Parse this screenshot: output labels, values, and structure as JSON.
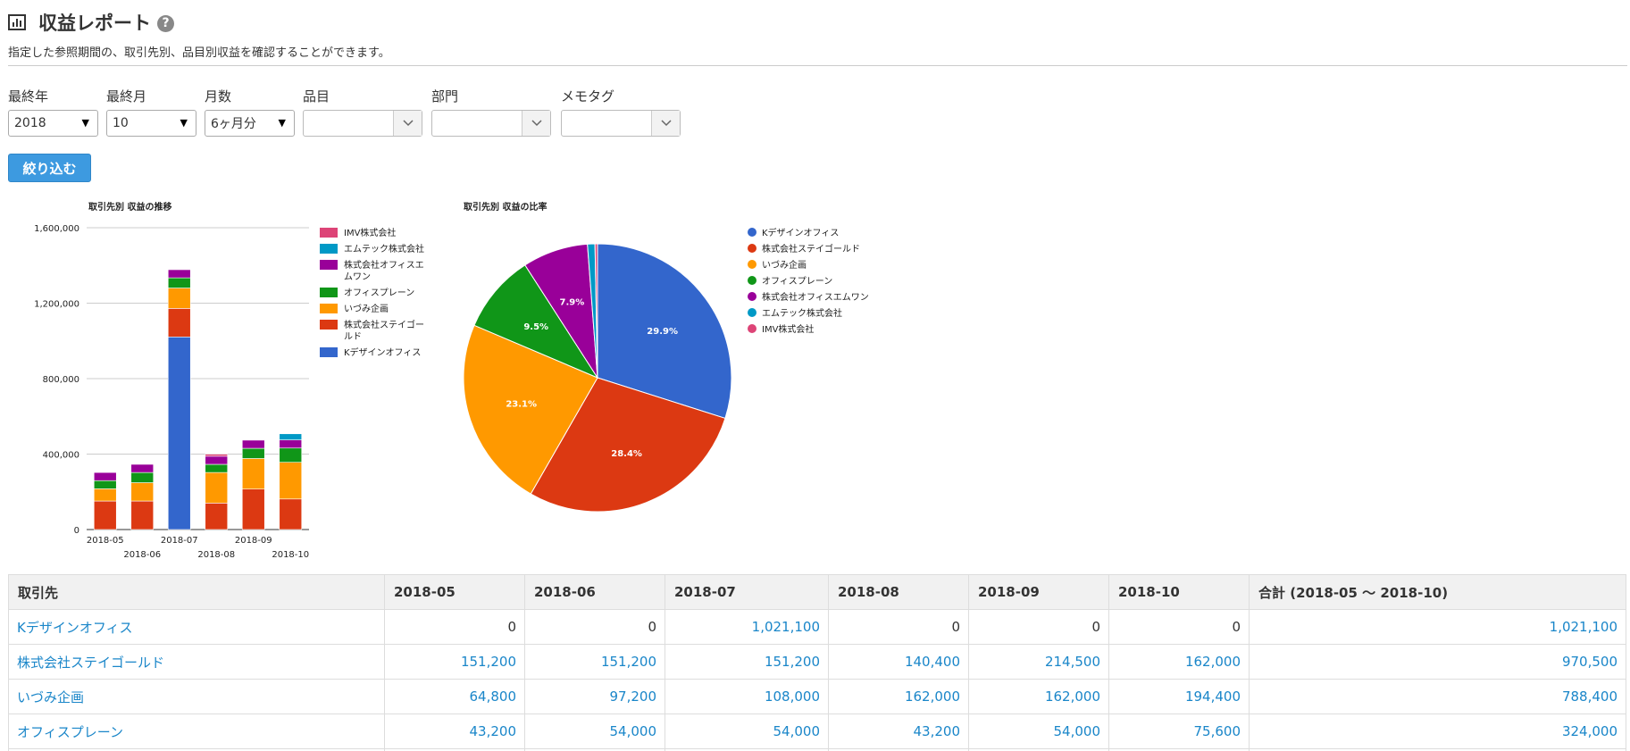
{
  "header": {
    "title": "収益レポート",
    "help": "?",
    "subtitle": "指定した参照期間の、取引先別、品目別収益を確認することができます。"
  },
  "filters": {
    "year_label": "最終年",
    "year_value": "2018",
    "month_label": "最終月",
    "month_value": "10",
    "count_label": "月数",
    "count_value": "6ヶ月分",
    "item_label": "品目",
    "dept_label": "部門",
    "tag_label": "メモタグ",
    "submit_label": "絞り込む"
  },
  "colors": {
    "kdesign": "#3366cc",
    "steigold": "#dc3912",
    "izumi": "#ff9900",
    "officeplane": "#109618",
    "officeone": "#990099",
    "emtech": "#0099c6",
    "imv": "#dd4477",
    "accent": "#3d9ae0",
    "link": "#1a86c9"
  },
  "chart_data": [
    {
      "type": "bar",
      "stacked": true,
      "title": "取引先別 収益の推移",
      "categories": [
        "2018-05",
        "2018-06",
        "2018-07",
        "2018-08",
        "2018-09",
        "2018-10"
      ],
      "ylim": [
        0,
        1600000
      ],
      "yticks": [
        "0",
        "400,000",
        "800,000",
        "1,200,000",
        "1,600,000"
      ],
      "grid": true,
      "legend_position": "right",
      "series": [
        {
          "name": "Kデザインオフィス",
          "color": "#3366cc",
          "values": [
            0,
            0,
            1021100,
            0,
            0,
            0
          ]
        },
        {
          "name": "株式会社ステイゴールド",
          "color": "#dc3912",
          "values": [
            151200,
            151200,
            151200,
            140400,
            214500,
            162000
          ]
        },
        {
          "name": "いづみ企画",
          "color": "#ff9900",
          "values": [
            64800,
            97200,
            108000,
            162000,
            162000,
            194400
          ]
        },
        {
          "name": "オフィスプレーン",
          "color": "#109618",
          "values": [
            43200,
            54000,
            54000,
            43200,
            54000,
            75600
          ]
        },
        {
          "name": "株式会社オフィスエムワン",
          "color": "#990099",
          "values": [
            43200,
            43200,
            43200,
            43200,
            43200,
            43200
          ]
        },
        {
          "name": "エムテック株式会社",
          "color": "#0099c6",
          "values": [
            0,
            0,
            0,
            0,
            0,
            32400
          ]
        },
        {
          "name": "IMV株式会社",
          "color": "#dd4477",
          "values": [
            0,
            0,
            0,
            10800,
            0,
            0
          ]
        }
      ],
      "legend_order": [
        "IMV株式会社",
        "エムテック株式会社",
        "株式会社オフィスエムワン",
        "オフィスプレーン",
        "いづみ企画",
        "株式会社ステイゴールド",
        "Kデザインオフィス"
      ]
    },
    {
      "type": "pie",
      "title": "取引先別 収益の比率",
      "legend_position": "right",
      "slices": [
        {
          "name": "Kデザインオフィス",
          "color": "#3366cc",
          "percent": 29.9,
          "label": "29.9%"
        },
        {
          "name": "株式会社ステイゴールド",
          "color": "#dc3912",
          "percent": 28.4,
          "label": "28.4%"
        },
        {
          "name": "いづみ企画",
          "color": "#ff9900",
          "percent": 23.1,
          "label": "23.1%"
        },
        {
          "name": "オフィスプレーン",
          "color": "#109618",
          "percent": 9.5,
          "label": "9.5%"
        },
        {
          "name": "株式会社オフィスエムワン",
          "color": "#990099",
          "percent": 7.9,
          "label": "7.9%"
        },
        {
          "name": "エムテック株式会社",
          "color": "#0099c6",
          "percent": 0.9,
          "label": ""
        },
        {
          "name": "IMV株式会社",
          "color": "#dd4477",
          "percent": 0.3,
          "label": ""
        }
      ]
    }
  ],
  "table": {
    "headers": [
      "取引先",
      "2018-05",
      "2018-06",
      "2018-07",
      "2018-08",
      "2018-09",
      "2018-10",
      "合計 (2018-05 〜 2018-10)"
    ],
    "rows": [
      {
        "name": "Kデザインオフィス",
        "cells": [
          "0",
          "0",
          "1,021,100",
          "0",
          "0",
          "0",
          "1,021,100"
        ]
      },
      {
        "name": "株式会社ステイゴールド",
        "cells": [
          "151,200",
          "151,200",
          "151,200",
          "140,400",
          "214,500",
          "162,000",
          "970,500"
        ]
      },
      {
        "name": "いづみ企画",
        "cells": [
          "64,800",
          "97,200",
          "108,000",
          "162,000",
          "162,000",
          "194,400",
          "788,400"
        ]
      },
      {
        "name": "オフィスプレーン",
        "cells": [
          "43,200",
          "54,000",
          "54,000",
          "43,200",
          "54,000",
          "75,600",
          "324,000"
        ]
      },
      {
        "name": "",
        "cells": [
          "",
          "",
          "",
          "",
          "",
          "",
          ""
        ]
      }
    ]
  }
}
